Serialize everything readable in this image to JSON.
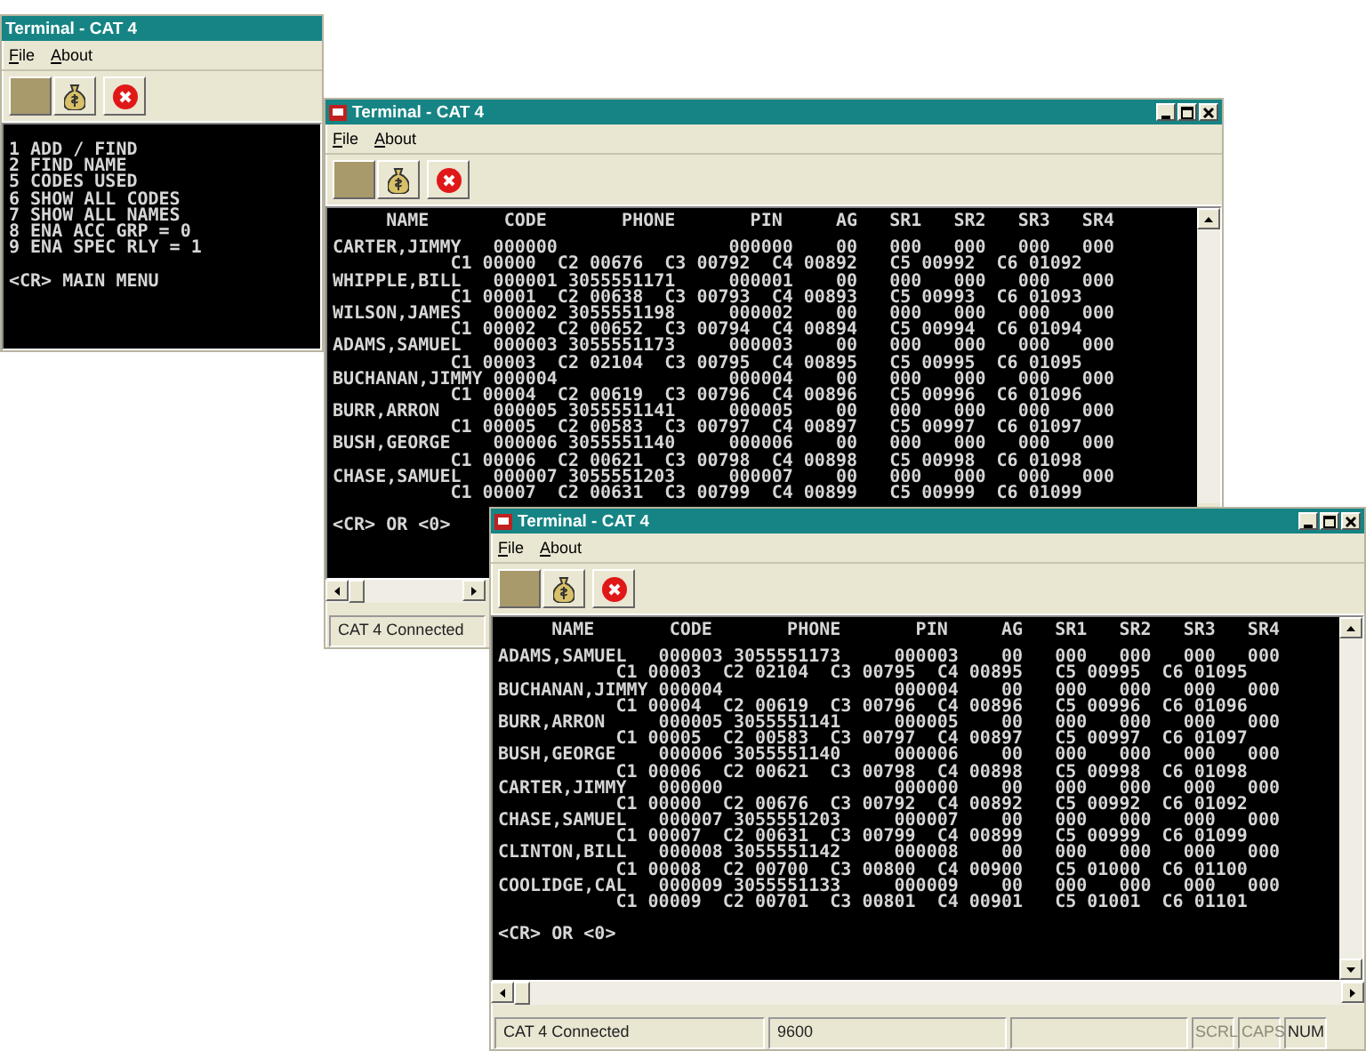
{
  "windows": [
    {
      "title": "Terminal - CAT 4",
      "app_icon": false,
      "caption_buttons": false,
      "menu": [
        "File",
        "About"
      ],
      "toolbar": [
        {
          "kind": "blank"
        },
        {
          "kind": "bag"
        },
        {
          "kind": "stop"
        }
      ],
      "scrollbars": false,
      "terminal": {
        "lines": [
          "1 ADD / FIND",
          "2 FIND NAME",
          "5 CODES USED",
          "6 SHOW ALL CODES",
          "7 SHOW ALL NAMES",
          "8 ENA ACC GRP = 0",
          "9 ENA SPEC RLY = 1"
        ],
        "prompt": "<CR> MAIN MENU"
      }
    },
    {
      "title": "Terminal - CAT 4",
      "app_icon": true,
      "caption_buttons": true,
      "menu": [
        "File",
        "About"
      ],
      "toolbar": [
        {
          "kind": "blank"
        },
        {
          "kind": "bag"
        },
        {
          "kind": "stop"
        }
      ],
      "scrollbars": true,
      "terminal": {
        "header": "     NAME       CODE       PHONE       PIN     AG   SR1   SR2   SR3   SR4",
        "lines": [
          "CARTER,JIMMY   000000                000000    00   000   000   000   000",
          "           C1 00000  C2 00676  C3 00792  C4 00892   C5 00992  C6 01092",
          "WHIPPLE,BILL   000001 3055551171     000001    00   000   000   000   000",
          "           C1 00001  C2 00638  C3 00793  C4 00893   C5 00993  C6 01093",
          "WILSON,JAMES   000002 3055551198     000002    00   000   000   000   000",
          "           C1 00002  C2 00652  C3 00794  C4 00894   C5 00994  C6 01094",
          "ADAMS,SAMUEL   000003 3055551173     000003    00   000   000   000   000",
          "           C1 00003  C2 02104  C3 00795  C4 00895   C5 00995  C6 01095",
          "BUCHANAN,JIMMY 000004                000004    00   000   000   000   000",
          "           C1 00004  C2 00619  C3 00796  C4 00896   C5 00996  C6 01096",
          "BURR,ARRON     000005 3055551141     000005    00   000   000   000   000",
          "           C1 00005  C2 00583  C3 00797  C4 00897   C5 00997  C6 01097",
          "BUSH,GEORGE    000006 3055551140     000006    00   000   000   000   000",
          "           C1 00006  C2 00621  C3 00798  C4 00898   C5 00998  C6 01098",
          "CHASE,SAMUEL   000007 3055551203     000007    00   000   000   000   000",
          "           C1 00007  C2 00631  C3 00799  C4 00899   C5 00999  C6 01099"
        ],
        "prompt": "<CR> OR <0>"
      },
      "status": {
        "fields": [
          "CAT 4 Connected"
        ]
      }
    },
    {
      "title": "Terminal - CAT 4",
      "app_icon": true,
      "caption_buttons": true,
      "menu": [
        "File",
        "About"
      ],
      "toolbar": [
        {
          "kind": "blank"
        },
        {
          "kind": "bag"
        },
        {
          "kind": "stop"
        }
      ],
      "scrollbars": true,
      "terminal": {
        "header": "     NAME       CODE       PHONE       PIN     AG   SR1   SR2   SR3   SR4",
        "lines": [
          "ADAMS,SAMUEL   000003 3055551173     000003    00   000   000   000   000",
          "           C1 00003  C2 02104  C3 00795  C4 00895   C5 00995  C6 01095",
          "BUCHANAN,JIMMY 000004                000004    00   000   000   000   000",
          "           C1 00004  C2 00619  C3 00796  C4 00896   C5 00996  C6 01096",
          "BURR,ARRON     000005 3055551141     000005    00   000   000   000   000",
          "           C1 00005  C2 00583  C3 00797  C4 00897   C5 00997  C6 01097",
          "BUSH,GEORGE    000006 3055551140     000006    00   000   000   000   000",
          "           C1 00006  C2 00621  C3 00798  C4 00898   C5 00998  C6 01098",
          "CARTER,JIMMY   000000                000000    00   000   000   000   000",
          "           C1 00000  C2 00676  C3 00792  C4 00892   C5 00992  C6 01092",
          "CHASE,SAMUEL   000007 3055551203     000007    00   000   000   000   000",
          "           C1 00007  C2 00631  C3 00799  C4 00899   C5 00999  C6 01099",
          "CLINTON,BILL   000008 3055551142     000008    00   000   000   000   000",
          "           C1 00008  C2 00700  C3 00800  C4 00900   C5 01000  C6 01100",
          "COOLIDGE,CAL   000009 3055551133     000009    00   000   000   000   000",
          "           C1 00009  C2 00701  C3 00801  C4 00901   C5 01001  C6 01101"
        ],
        "prompt": "<CR> OR <0>"
      },
      "status": {
        "fields": [
          "CAT 4 Connected",
          "9600"
        ],
        "indicators": [
          {
            "label": "SCRL",
            "on": false
          },
          {
            "label": "CAPS",
            "on": false
          },
          {
            "label": "NUM",
            "on": true
          }
        ]
      }
    }
  ]
}
